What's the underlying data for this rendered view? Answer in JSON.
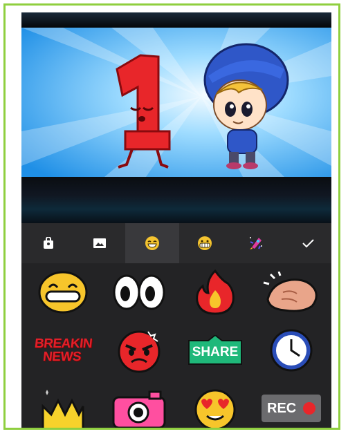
{
  "toolbar": {
    "tabs": [
      {
        "name": "bag-icon"
      },
      {
        "name": "image-icon"
      },
      {
        "name": "emoji-icon",
        "active": true
      },
      {
        "name": "grin-emoji-icon"
      },
      {
        "name": "rocket-icon"
      },
      {
        "name": "check-icon"
      }
    ],
    "accent": "#f4c430"
  },
  "stickers": {
    "breaking_news": {
      "line1": "BREAKIN",
      "line2": "NEWS"
    },
    "share": {
      "label": "SHARE"
    },
    "rec": {
      "label": "REC"
    }
  },
  "colors": {
    "frame": "#8fcf3f",
    "panel": "#232325",
    "toolbar": "#2a2a2c"
  }
}
